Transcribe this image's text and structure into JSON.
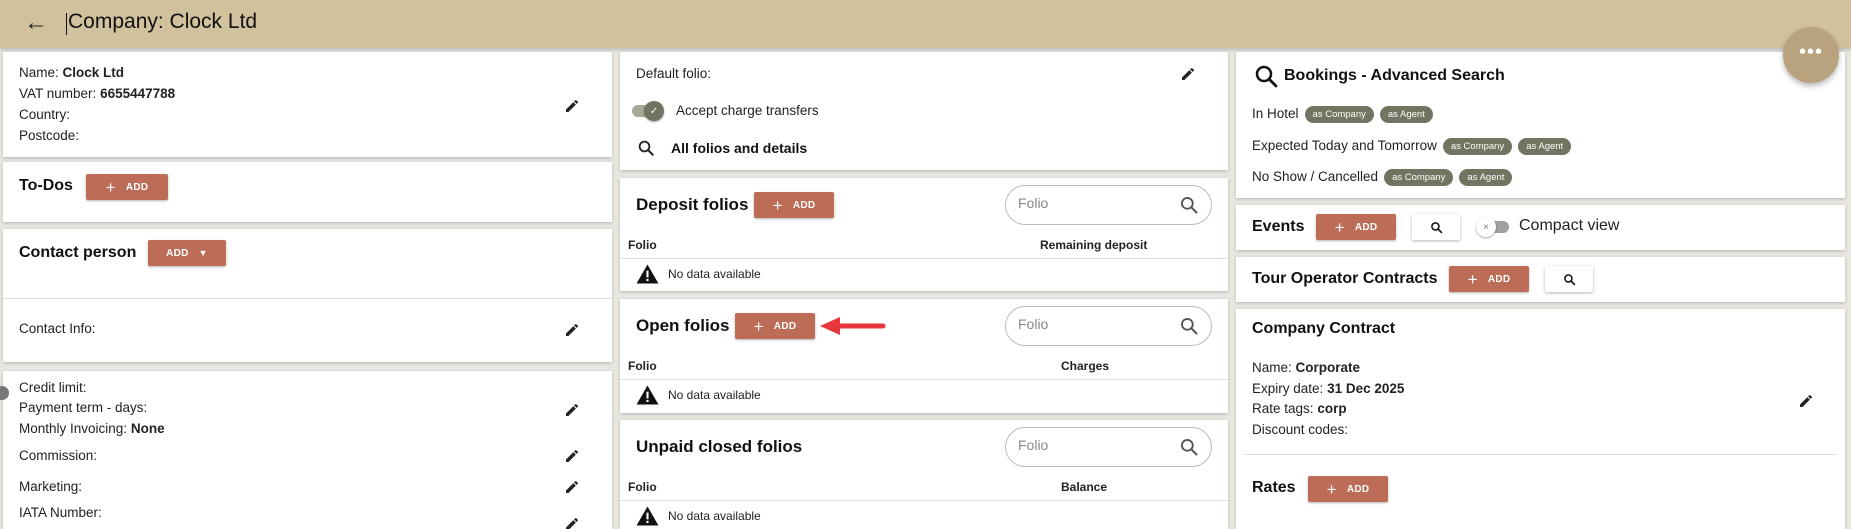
{
  "header": {
    "title": "Company: Clock Ltd",
    "more_label": "•••"
  },
  "company": {
    "name_label": "Name:",
    "name_value": "Clock Ltd",
    "vat_label": "VAT number:",
    "vat_value": "6655447788",
    "country_label": "Country:",
    "postcode_label": "Postcode:"
  },
  "todos": {
    "title": "To-Dos",
    "add_label": "ADD"
  },
  "contact": {
    "title": "Contact person",
    "add_label": "ADD",
    "info_label": "Contact Info:"
  },
  "finance": {
    "credit_limit_label": "Credit limit:",
    "payment_term_label": "Payment term - days:",
    "monthly_invoicing_label": "Monthly Invoicing:",
    "monthly_invoicing_value": "None",
    "commission_label": "Commission:",
    "marketing_label": "Marketing:",
    "iata_label": "IATA Number:"
  },
  "folio_settings": {
    "default_folio_label": "Default folio:",
    "accept_transfers_label": "Accept charge transfers",
    "accept_transfers_on": true,
    "all_folios_label": "All folios and details"
  },
  "deposit_folios": {
    "title": "Deposit folios",
    "add_label": "ADD",
    "search_placeholder": "Folio",
    "columns": [
      "Folio",
      "Remaining deposit"
    ],
    "empty_text": "No data available"
  },
  "open_folios": {
    "title": "Open folios",
    "add_label": "ADD",
    "search_placeholder": "Folio",
    "columns": [
      "Folio",
      "Charges"
    ],
    "empty_text": "No data available"
  },
  "unpaid_folios": {
    "title": "Unpaid closed folios",
    "search_placeholder": "Folio",
    "columns": [
      "Folio",
      "Balance"
    ],
    "empty_text": "No data available"
  },
  "bookings": {
    "title": "Bookings - Advanced Search",
    "rows": [
      {
        "label": "In Hotel",
        "chips": [
          "as Company",
          "as Agent"
        ]
      },
      {
        "label": "Expected Today and Tomorrow",
        "chips": [
          "as Company",
          "as Agent"
        ]
      },
      {
        "label": "No Show / Cancelled",
        "chips": [
          "as Company",
          "as Agent"
        ]
      }
    ]
  },
  "events": {
    "title": "Events",
    "add_label": "ADD",
    "compact_label": "Compact view",
    "compact_on": false
  },
  "tour_operator": {
    "title": "Tour Operator Contracts",
    "add_label": "ADD"
  },
  "company_contract": {
    "title": "Company Contract",
    "name_label": "Name:",
    "name_value": "Corporate",
    "expiry_label": "Expiry date:",
    "expiry_value": "31 Dec 2025",
    "rate_tags_label": "Rate tags:",
    "rate_tags_value": "corp",
    "discount_label": "Discount codes:"
  },
  "rates": {
    "title": "Rates",
    "add_label": "ADD"
  },
  "colors": {
    "header_bg": "#d1c19c",
    "accent": "#bc6c57",
    "chip": "#6f7560",
    "fab": "#b9a37f",
    "arrow": "#e8373a"
  }
}
